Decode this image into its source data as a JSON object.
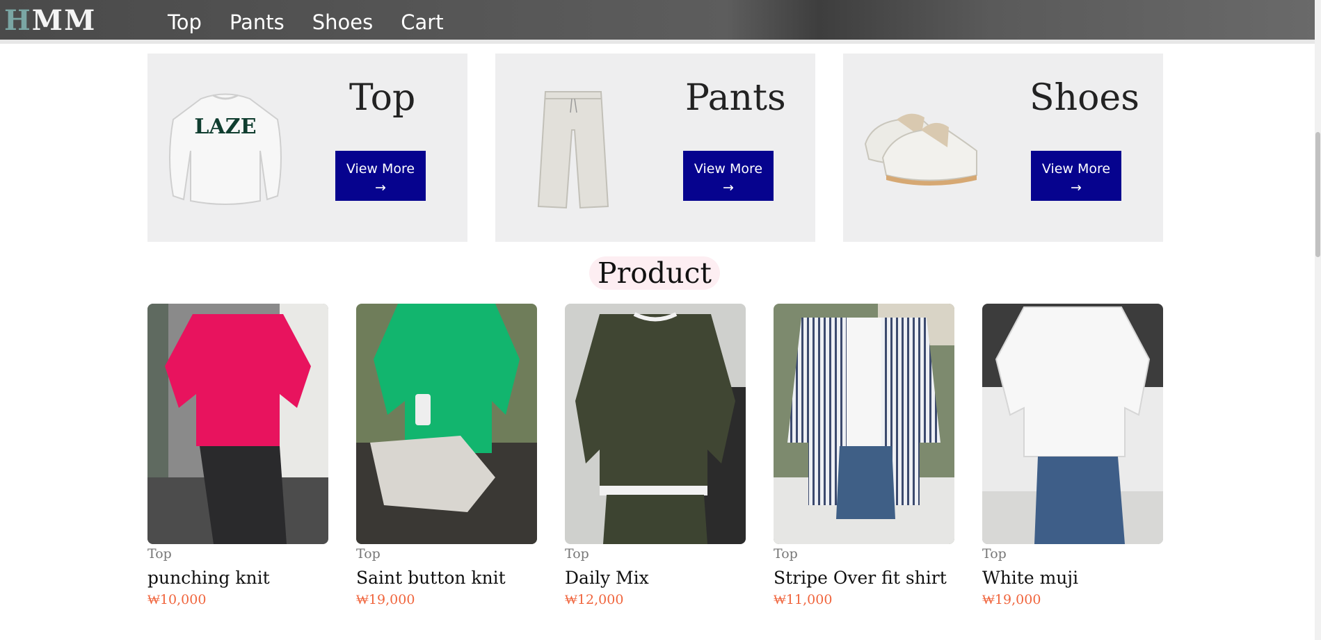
{
  "nav": {
    "logo_first": "H",
    "logo_rest": "MM",
    "links": [
      "Top",
      "Pants",
      "Shoes",
      "Cart"
    ]
  },
  "categories": [
    {
      "title": "Top",
      "button": "View More",
      "arrow": "→"
    },
    {
      "title": "Pants",
      "button": "View More",
      "arrow": "→"
    },
    {
      "title": "Shoes",
      "button": "View More",
      "arrow": "→"
    }
  ],
  "section": {
    "title": "Product"
  },
  "products": [
    {
      "category": "Top",
      "name": "punching knit",
      "price": "₩10,000"
    },
    {
      "category": "Top",
      "name": "Saint button knit",
      "price": "₩19,000"
    },
    {
      "category": "Top",
      "name": "Daily Mix",
      "price": "₩12,000"
    },
    {
      "category": "Top",
      "name": "Stripe Over fit shirt",
      "price": "₩11,000"
    },
    {
      "category": "Top",
      "name": "White muji",
      "price": "₩19,000"
    }
  ],
  "colors": {
    "button_bg": "#06038e",
    "price": "#f0643c",
    "section_pill": "#fdeef2",
    "card_bg": "#eeeeef"
  }
}
